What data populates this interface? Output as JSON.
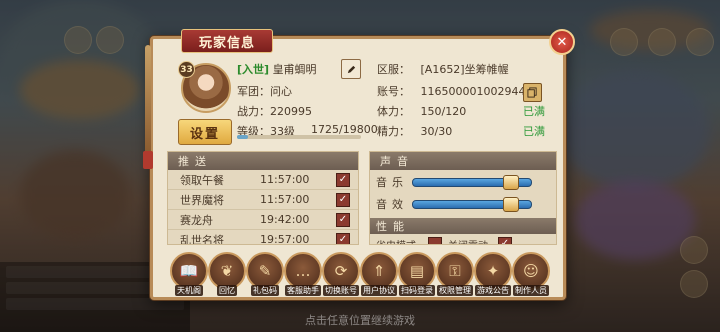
{
  "dialog": {
    "title": "玩家信息",
    "close_icon": "close-icon"
  },
  "player": {
    "level_badge": "33",
    "faction_tag": "[入世]",
    "name": "皇甫蜩明",
    "guild_label": "军团：",
    "guild_value": "问心",
    "power_label": "战力：",
    "power_value": "220995",
    "grade_label": "等级：",
    "grade_value": "33级",
    "exp_text": "1725/19800",
    "exp_fraction": 0.087,
    "settings_label": "设置"
  },
  "account": {
    "server_label": "区服：",
    "server_value": "[A1652]坐筹帷幄",
    "id_label": "账号：",
    "id_value": "116500001002944",
    "stamina_label": "体力：",
    "stamina_value": "150/120",
    "stamina_status": "已满",
    "energy_label": "精力：",
    "energy_value": "30/30",
    "energy_status": "已满"
  },
  "push": {
    "title": "推送",
    "items": [
      {
        "name": "领取午餐",
        "time": "11:57:00",
        "checked": true
      },
      {
        "name": "世界魔将",
        "time": "11:57:00",
        "checked": true
      },
      {
        "name": "赛龙舟",
        "time": "19:42:00",
        "checked": true
      },
      {
        "name": "乱世名将",
        "time": "19:57:00",
        "checked": true
      }
    ]
  },
  "sound": {
    "title": "声音",
    "music_label": "音乐",
    "music_level": 0.83,
    "effect_label": "音效",
    "effect_level": 0.83,
    "perf_title": "性能",
    "power_save_label": "省电模式",
    "vibrate_label": "关闭震动"
  },
  "buttons": [
    {
      "label": "天机阁",
      "icon": "book-icon"
    },
    {
      "label": "回忆",
      "icon": "leaf-icon"
    },
    {
      "label": "礼包码",
      "icon": "ticket-icon"
    },
    {
      "label": "客服助手",
      "icon": "chat-icon"
    },
    {
      "label": "切换账号",
      "icon": "switch-icon"
    },
    {
      "label": "用户协议",
      "icon": "up-arrow-icon"
    },
    {
      "label": "扫码登录",
      "icon": "scan-icon"
    },
    {
      "label": "权限管理",
      "icon": "lock-icon"
    },
    {
      "label": "游戏公告",
      "icon": "horn-icon"
    },
    {
      "label": "制作人员",
      "icon": "people-icon"
    }
  ],
  "hint": "点击任意位置继续游戏",
  "colors": {
    "accent": "#a83a34",
    "frame": "#b88b58",
    "ok": "#2f9a3a",
    "slider": "#2b6db0"
  }
}
